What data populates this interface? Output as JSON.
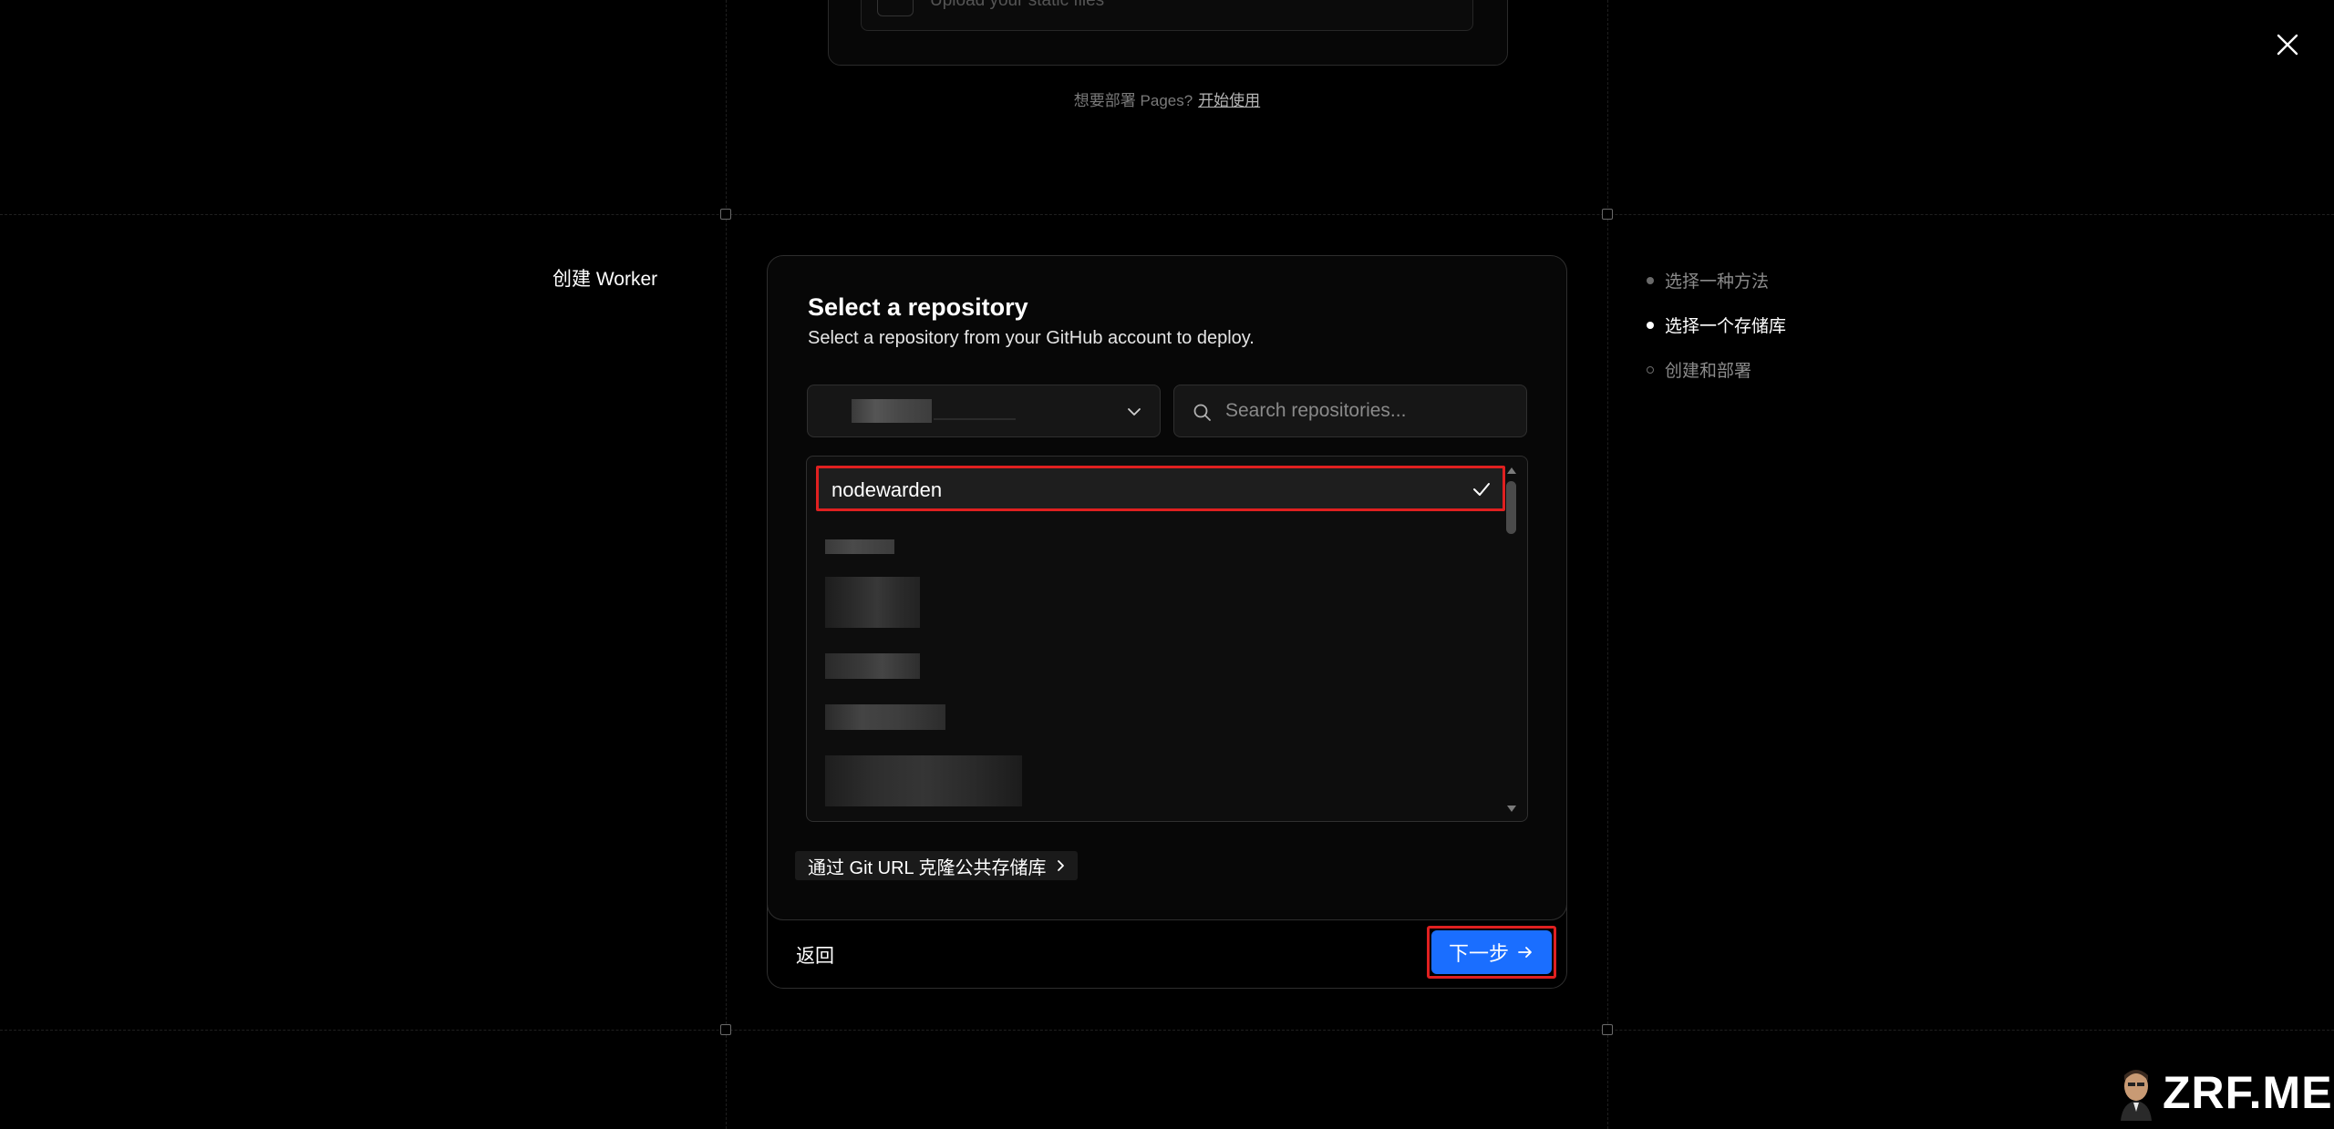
{
  "top_card": {
    "upload_text": "Upload your static files"
  },
  "pages_hint": {
    "text": "想要部署 Pages?",
    "link": "开始使用"
  },
  "section_title": "创建 Worker",
  "panel": {
    "title": "Select a repository",
    "subtitle": "Select a repository from your GitHub account to deploy.",
    "search": {
      "placeholder": "Search repositories..."
    },
    "repos": [
      {
        "name": "nodewarden",
        "selected": true
      }
    ],
    "git_url_link": "通过 Git URL 克隆公共存储库"
  },
  "footer": {
    "back": "返回",
    "next": "下一步"
  },
  "steps": [
    {
      "label": "选择一种方法",
      "state": "done"
    },
    {
      "label": "选择一个存储库",
      "state": "current"
    },
    {
      "label": "创建和部署",
      "state": "pending"
    }
  ],
  "watermark": "ZRF.ME",
  "colors": {
    "accent": "#1a6eff",
    "highlight": "#e02020",
    "background": "#000000"
  }
}
